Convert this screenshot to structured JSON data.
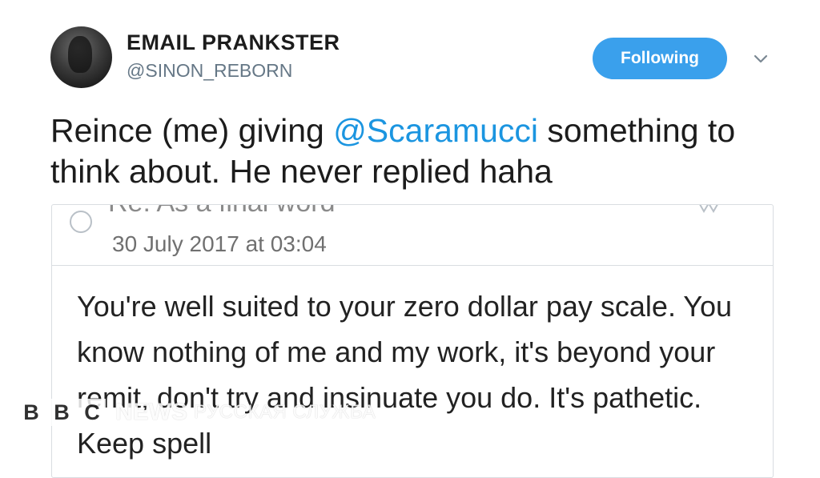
{
  "tweet": {
    "display_name": "EMAIL PRANKSTER",
    "handle": "@SINON_REBORN",
    "follow_button_label": "Following",
    "text_before": "Reince (me) giving ",
    "mention": "@Scaramucci",
    "text_after": " something to think about. He never replied haha",
    "icons": [
      "avatar",
      "chevron-down-icon"
    ]
  },
  "email": {
    "subject_partial": "Re: As a final word",
    "date": "30 July 2017 at 03:04",
    "body": "You're well suited to your zero dollar pay scale. You know nothing of me and my work, it's beyond your remit, don't try and insinuate you do. It's pathetic. Keep spell",
    "icons": [
      "radio-circle-icon",
      "star-icon"
    ]
  },
  "watermark": {
    "letters": [
      "B",
      "B",
      "C"
    ],
    "news": "NEWS",
    "service": "РУССКАЯ СЛУЖБА"
  },
  "colors": {
    "accent": "#1b95e0",
    "follow_button": "#3aa0ec",
    "handle": "#657786",
    "border": "#d9dde1"
  }
}
